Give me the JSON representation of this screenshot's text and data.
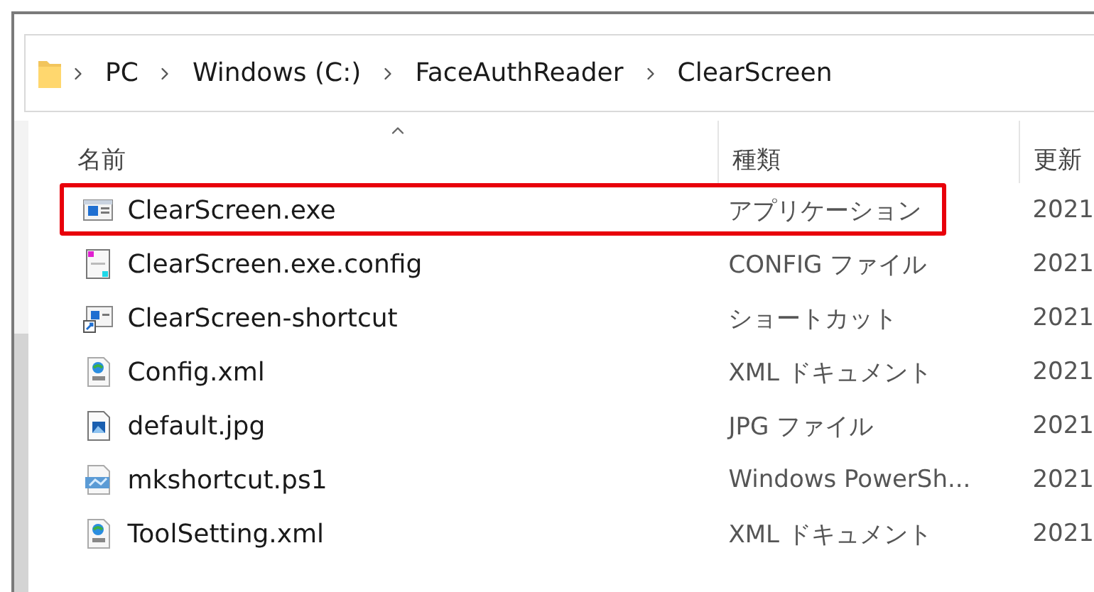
{
  "breadcrumb": [
    "PC",
    "Windows (C:)",
    "FaceAuthReader",
    "ClearScreen"
  ],
  "columns": [
    {
      "label": "名前",
      "sorted": true
    },
    {
      "label": "種類",
      "sorted": false
    },
    {
      "label": "更新",
      "sorted": false
    }
  ],
  "files": [
    {
      "name": "ClearScreen.exe",
      "kind": "exe",
      "type": "アプリケーション",
      "date": "2021",
      "highlighted": true
    },
    {
      "name": "ClearScreen.exe.config",
      "kind": "config",
      "type": "CONFIG ファイル",
      "date": "2021",
      "highlighted": false
    },
    {
      "name": "ClearScreen-shortcut",
      "kind": "shortcut",
      "type": "ショートカット",
      "date": "2021",
      "highlighted": false
    },
    {
      "name": "Config.xml",
      "kind": "xml",
      "type": "XML ドキュメント",
      "date": "2021",
      "highlighted": false
    },
    {
      "name": "default.jpg",
      "kind": "image",
      "type": "JPG ファイル",
      "date": "2021",
      "highlighted": false
    },
    {
      "name": "mkshortcut.ps1",
      "kind": "script",
      "type": "Windows PowerSh...",
      "date": "2021",
      "highlighted": false
    },
    {
      "name": "ToolSetting.xml",
      "kind": "xml",
      "type": "XML ドキュメント",
      "date": "2021",
      "highlighted": false
    }
  ]
}
